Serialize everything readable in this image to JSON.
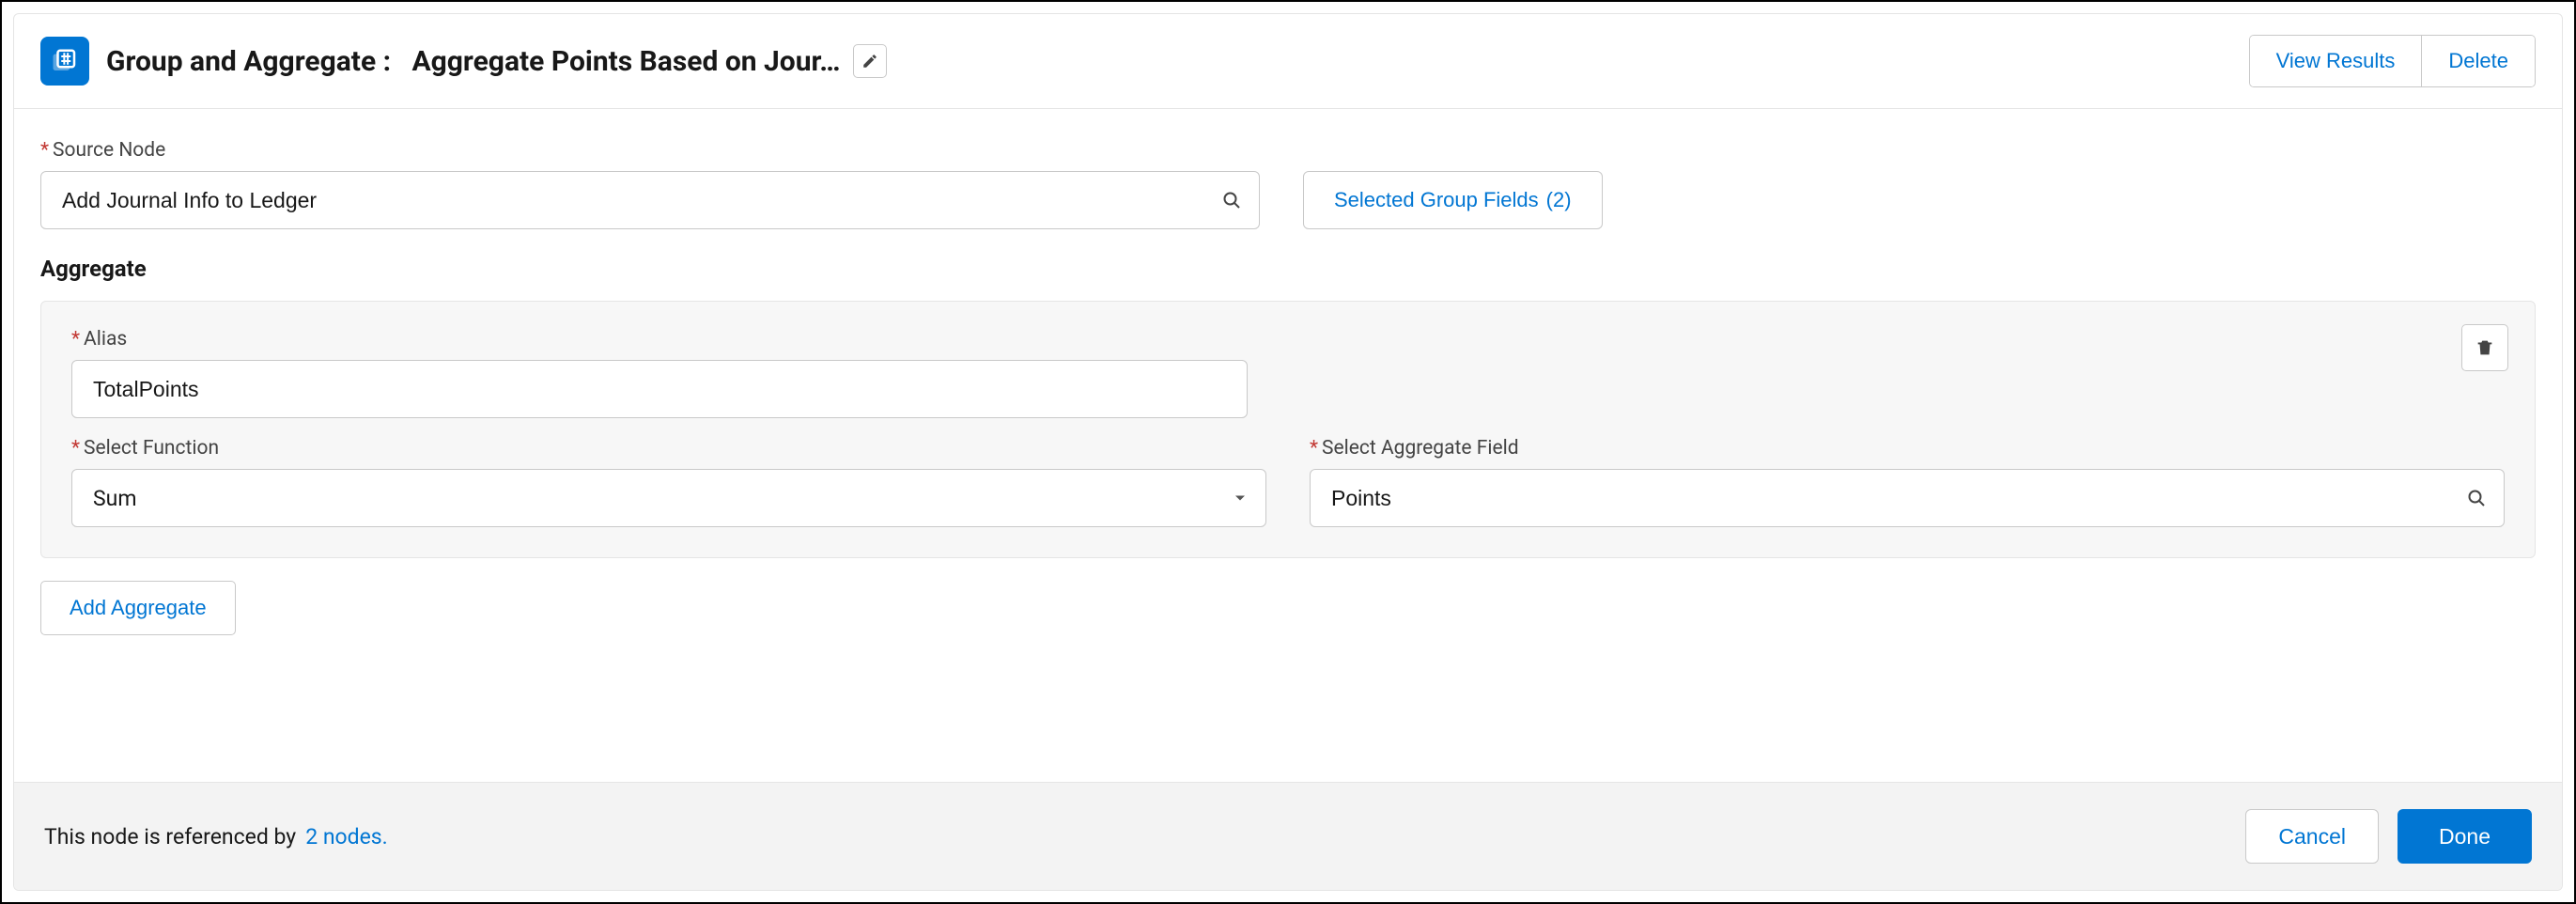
{
  "header": {
    "type_label": "Group and Aggregate",
    "title": "Aggregate Points Based on Jour…",
    "actions": {
      "view_results": "View Results",
      "delete": "Delete"
    }
  },
  "body": {
    "source_node": {
      "label": "Source Node",
      "value": "Add Journal Info to Ledger"
    },
    "group_fields_button": {
      "label": "Selected Group Fields",
      "count": "(2)"
    },
    "aggregate_section_title": "Aggregate",
    "aggregate": {
      "alias": {
        "label": "Alias",
        "value": "TotalPoints"
      },
      "function": {
        "label": "Select Function",
        "value": "Sum"
      },
      "field": {
        "label": "Select Aggregate Field",
        "value": "Points"
      }
    },
    "add_aggregate_label": "Add Aggregate"
  },
  "footer": {
    "ref_text": "This node is referenced by",
    "ref_link": "2 nodes.",
    "cancel": "Cancel",
    "done": "Done"
  }
}
